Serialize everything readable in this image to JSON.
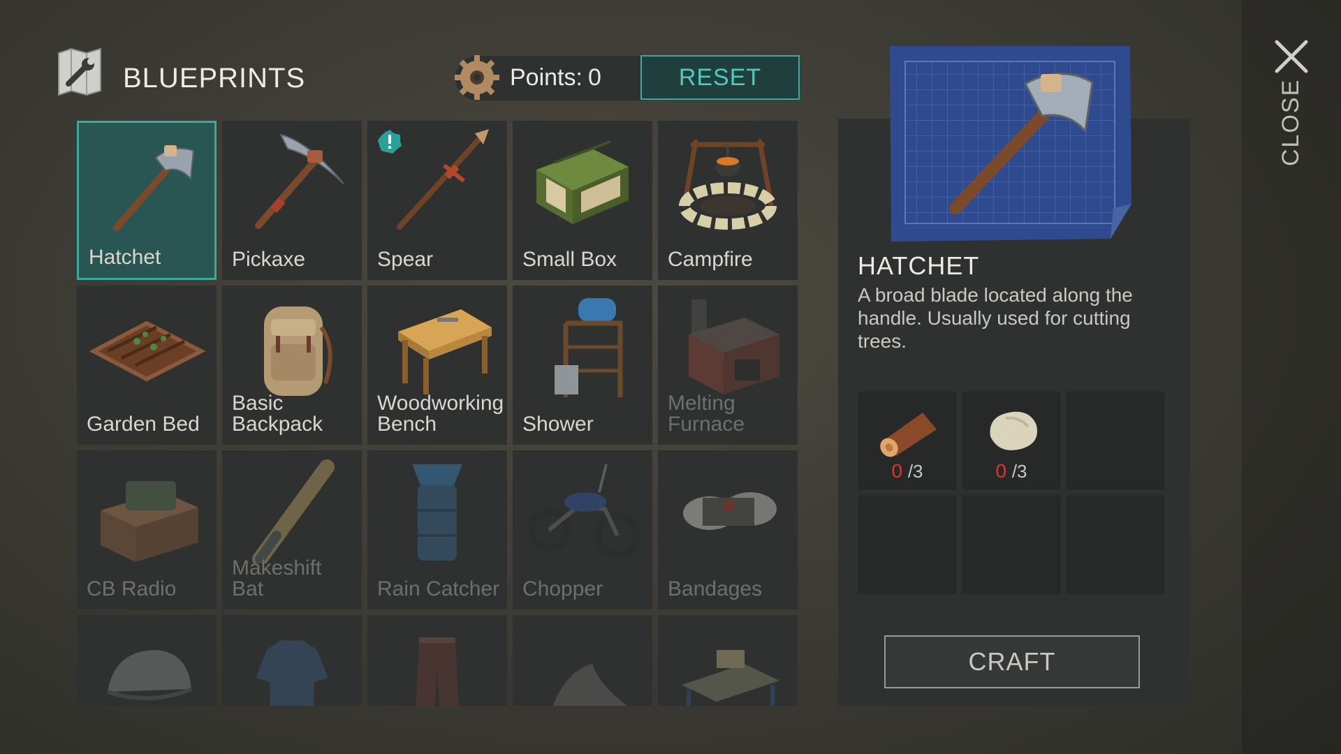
{
  "header": {
    "title": "BLUEPRINTS",
    "title_icon": "blueprint-wrench-icon",
    "points_icon": "gear-icon",
    "points_label": "Points:",
    "points_value": "0",
    "reset_label": "RESET"
  },
  "grid": {
    "items": [
      {
        "label": "Hatchet",
        "icon": "hatchet-icon",
        "state": "selected"
      },
      {
        "label": "Pickaxe",
        "icon": "pickaxe-icon",
        "state": "available"
      },
      {
        "label": "Spear",
        "icon": "spear-icon",
        "state": "available",
        "alert": "!"
      },
      {
        "label": "Small Box",
        "icon": "small-box-icon",
        "state": "available"
      },
      {
        "label": "Campfire",
        "icon": "campfire-icon",
        "state": "available"
      },
      {
        "label": "Garden Bed",
        "icon": "garden-bed-icon",
        "state": "available"
      },
      {
        "label": "Basic\nBackpack",
        "icon": "backpack-icon",
        "state": "available"
      },
      {
        "label": "Woodworking\nBench",
        "icon": "workbench-icon",
        "state": "available"
      },
      {
        "label": "Shower",
        "icon": "shower-icon",
        "state": "available"
      },
      {
        "label": "Melting\nFurnace",
        "icon": "furnace-icon",
        "state": "locked"
      },
      {
        "label": "CB Radio",
        "icon": "radio-icon",
        "state": "locked"
      },
      {
        "label": "Makeshift\nBat",
        "icon": "bat-icon",
        "state": "locked"
      },
      {
        "label": "Rain Catcher",
        "icon": "rain-catcher-icon",
        "state": "locked"
      },
      {
        "label": "Chopper",
        "icon": "motorcycle-icon",
        "state": "locked"
      },
      {
        "label": "Bandages",
        "icon": "bandages-icon",
        "state": "locked"
      },
      {
        "label": "",
        "icon": "cap-icon",
        "state": "locked"
      },
      {
        "label": "",
        "icon": "shirt-icon",
        "state": "locked"
      },
      {
        "label": "",
        "icon": "pants-icon",
        "state": "locked"
      },
      {
        "label": "",
        "icon": "shoes-icon",
        "state": "locked"
      },
      {
        "label": "",
        "icon": "table-icon",
        "state": "locked"
      }
    ]
  },
  "detail": {
    "name": "HATCHET",
    "description": "A broad blade located along the handle. Usually used for cutting trees.",
    "image_icon": "hatchet-blueprint-icon",
    "requirements": [
      {
        "icon": "log-icon",
        "have": "0",
        "need": "/3"
      },
      {
        "icon": "stone-icon",
        "have": "0",
        "need": "/3"
      }
    ],
    "craft_label": "CRAFT"
  },
  "close_label": "CLOSE",
  "colors": {
    "accent": "#3aa99f",
    "selected_bg": "#295552",
    "missing": "#e0332c"
  }
}
